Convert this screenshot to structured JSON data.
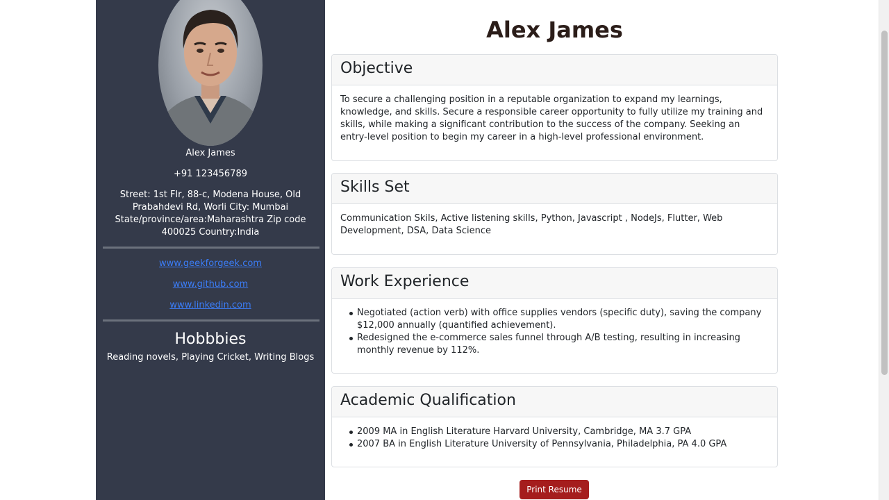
{
  "sidebar": {
    "name": "Alex James",
    "phone": "+91 123456789",
    "address": "Street: 1st Flr, 88-c, Modena House, Old Prabahdevi Rd, Worli City: Mumbai State/province/area:Maharashtra Zip code 400025 Country:India",
    "links": [
      "www.geekforgeek.com",
      "www.github.com",
      "www.linkedin.com"
    ],
    "hobbies_title": "Hobbbies",
    "hobbies_text": "Reading novels, Playing Cricket, Writing Blogs"
  },
  "main": {
    "title": "Alex James",
    "objective": {
      "heading": "Objective",
      "text": "To secure a challenging position in a reputable organization to expand my learnings, knowledge, and skills. Secure a responsible career opportunity to fully utilize my training and skills, while making a significant contribution to the success of the company. Seeking an entry-level position to begin my career in a high-level professional environment."
    },
    "skills": {
      "heading": "Skills Set",
      "text": "Communication Skils, Active listening skills, Python, Javascript , NodeJs, Flutter, Web Development, DSA, Data Science"
    },
    "experience": {
      "heading": "Work Experience",
      "items": [
        "Negotiated (action verb) with office supplies vendors (specific duty), saving the company $12,000 annually (quantified achievement).",
        "Redesigned the e-commerce sales funnel through A/B testing, resulting in increasing monthly revenue by 112%."
      ]
    },
    "academic": {
      "heading": "Academic Qualification",
      "items": [
        "2009 MA in English Literature Harvard University, Cambridge, MA 3.7 GPA",
        "2007 BA in English Literature University of Pennsylvania, Philadelphia, PA 4.0 GPA"
      ]
    },
    "print_label": "Print Resume"
  },
  "colors": {
    "sidebar_bg": "#343a4a",
    "link": "#3b7df8",
    "print_button": "#a51d1d",
    "title": "#2b1d19"
  },
  "icons": {
    "avatar": "profile-photo"
  }
}
